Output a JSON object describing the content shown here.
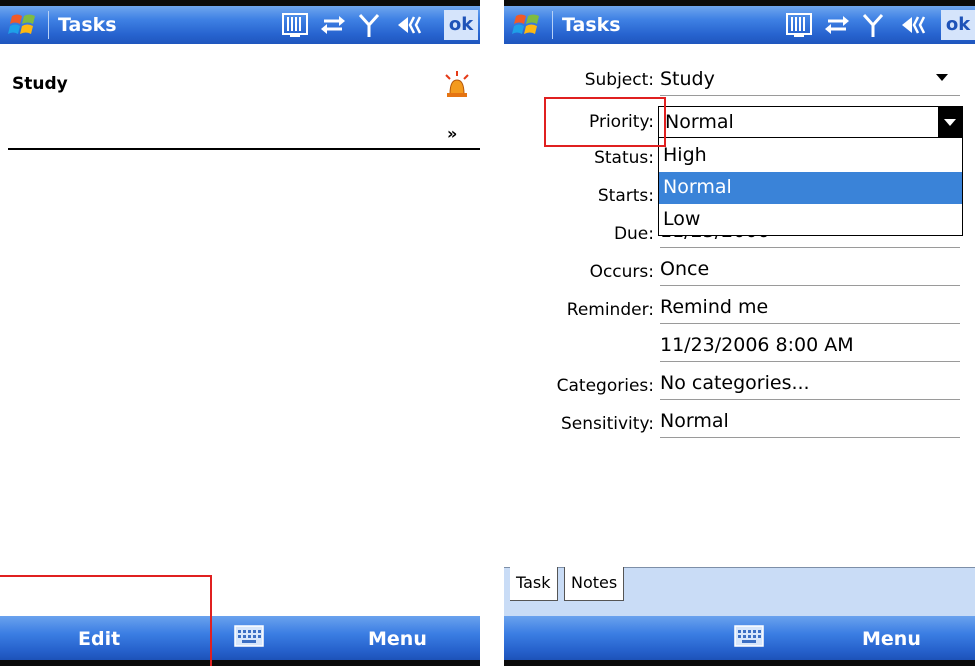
{
  "left_screen": {
    "title": "Tasks",
    "ok_label": "ok",
    "task_subject": "Study",
    "softkeys": {
      "left": "Edit",
      "right": "Menu"
    }
  },
  "right_screen": {
    "title": "Tasks",
    "ok_label": "ok",
    "fields": {
      "subject_label": "Subject:",
      "subject_value": "Study",
      "priority_label": "Priority:",
      "priority_value": "Normal",
      "status_label": "Status:",
      "starts_label": "Starts:",
      "due_label": "Due:",
      "due_value": "11/23/2006",
      "occurs_label": "Occurs:",
      "occurs_value": "Once",
      "reminder_label": "Reminder:",
      "reminder_value": "Remind me",
      "reminder_time": "11/23/2006  8:00 AM",
      "categories_label": "Categories:",
      "categories_value": "No categories...",
      "sensitivity_label": "Sensitivity:",
      "sensitivity_value": "Normal"
    },
    "priority_options": [
      "High",
      "Normal",
      "Low"
    ],
    "priority_selected": "Normal",
    "tabs": [
      "Task",
      "Notes"
    ],
    "softkeys": {
      "right": "Menu"
    }
  },
  "colors": {
    "titlebar": "#3f81e4",
    "selection": "#3a83d8",
    "annotation": "#e02020",
    "tab_strip": "#c9dcf6"
  },
  "icons": [
    "windows-logo-icon",
    "barcode-icon",
    "sync-icon",
    "signal-icon",
    "speaker-icon",
    "alarm-icon",
    "expand-icon",
    "keyboard-icon"
  ]
}
